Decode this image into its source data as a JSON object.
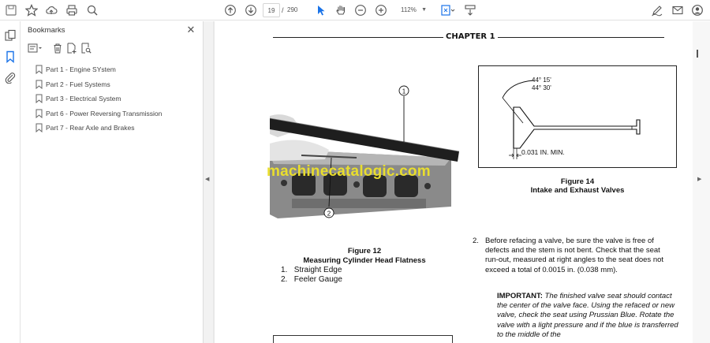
{
  "toolbar": {
    "page_current": "19",
    "page_separator": "/",
    "page_total": "290",
    "zoom": "112%"
  },
  "panel": {
    "title": "Bookmarks",
    "close_glyph": "✕",
    "items": [
      {
        "label": "Part 1 - Engine SYstem"
      },
      {
        "label": "Part 2 - Fuel Systems"
      },
      {
        "label": "Part 3 - Electrical System"
      },
      {
        "label": "Part 6 - Power Reversing Transmission"
      },
      {
        "label": "Part 7 - Rear Axle and Brakes"
      }
    ]
  },
  "document": {
    "chapter": "CHAPTER 1",
    "watermark": "machinecatalogic.com",
    "figure12": {
      "title": "Figure 12",
      "subtitle": "Measuring Cylinder Head Flatness",
      "callout1": "1",
      "callout2": "2",
      "items": [
        {
          "num": "1.",
          "text": "Straight Edge"
        },
        {
          "num": "2.",
          "text": "Feeler Gauge"
        }
      ]
    },
    "figure14": {
      "angle1": "44° 15'",
      "angle2": "44° 30'",
      "min_label": "0.031 IN. MIN.",
      "title": "Figure 14",
      "subtitle": "Intake and Exhaust Valves"
    },
    "step2": {
      "num": "2.",
      "text": "Before refacing a valve, be sure the valve is free of defects and the stem is not bent. Check that the seat run-out, measured at right angles to the seat does not exceed a total of 0.0015 in. (0.038 mm)."
    },
    "important": {
      "label": "IMPORTANT:",
      "text": "The finished valve seat should contact the center of the valve face. Using the refaced or new valve, check the seat using Prussian Blue. Rotate the valve with a light pressure and if the blue is transferred to the middle of the"
    }
  },
  "colors": {
    "watermark": "#e9de2e",
    "accent_blue": "#1a73e8"
  }
}
